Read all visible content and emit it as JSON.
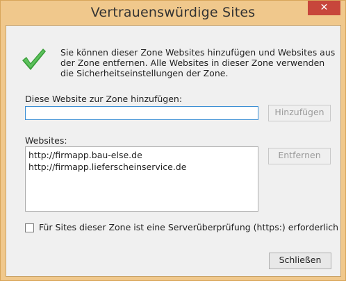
{
  "window": {
    "title": "Vertrauenswürdige Sites",
    "close_glyph": "✕"
  },
  "info": {
    "icon": "green-check-icon",
    "text": "Sie können dieser Zone Websites hinzufügen und Websites aus der Zone entfernen. Alle Websites in dieser Zone verwenden die Sicherheitseinstellungen der Zone."
  },
  "add_site": {
    "label": "Diese Website zur Zone hinzufügen:",
    "value": "",
    "button": "Hinzufügen"
  },
  "websites": {
    "label": "Websites:",
    "items": [
      "http://firmapp.bau-else.de",
      "http://firmapp.lieferscheinservice.de"
    ],
    "remove_button": "Entfernen"
  },
  "https_requirement": {
    "label": "Für Sites dieser Zone ist eine Serverüberprüfung (https:) erforderlich",
    "checked": false
  },
  "footer": {
    "close_button": "Schließen"
  },
  "colors": {
    "titlebar": "#f0c88c",
    "close_button": "#c7463b",
    "check_icon": "#3a9e3a",
    "dialog_background": "#f0f0f0"
  }
}
